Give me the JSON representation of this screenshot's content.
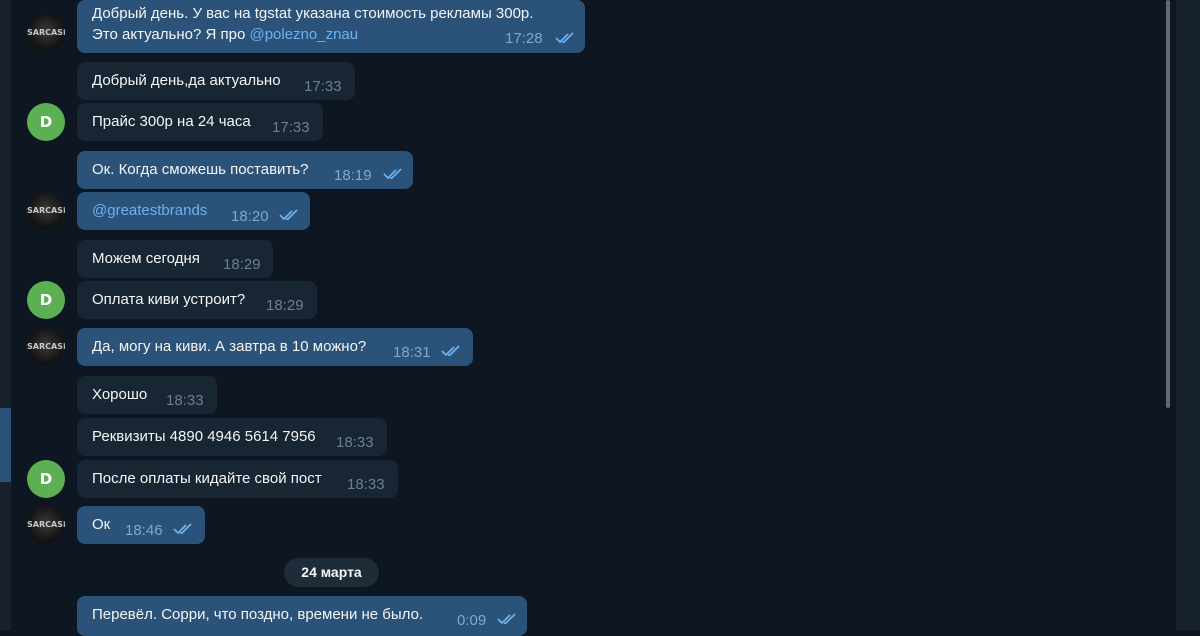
{
  "chat": {
    "messages": [
      {
        "dir": "out",
        "lines": [
          "Добрый день. У вас на tgstat указана стоимость рекламы 300р.",
          "Это актуально? Я про "
        ],
        "mention": "@polezno_znau",
        "time": "17:28",
        "read": true
      },
      {
        "dir": "in",
        "text": "Добрый день,да актуально",
        "time": "17:33"
      },
      {
        "dir": "in",
        "text": "Прайс 300р на 24 часа",
        "time": "17:33"
      },
      {
        "dir": "out",
        "text": "Ок. Когда сможешь поставить?",
        "time": "18:19",
        "read": true
      },
      {
        "dir": "out",
        "mention": "@greatestbrands",
        "time": "18:20",
        "read": true
      },
      {
        "dir": "in",
        "text": "Можем сегодня",
        "time": "18:29"
      },
      {
        "dir": "in",
        "text": "Оплата киви устроит?",
        "time": "18:29"
      },
      {
        "dir": "out",
        "text": "Да, могу на киви. А завтра в 10 можно?",
        "time": "18:31",
        "read": true
      },
      {
        "dir": "in",
        "text": "Хорошо",
        "time": "18:33"
      },
      {
        "dir": "in",
        "text": "Реквизиты 4890 4946 5614 7956",
        "time": "18:33"
      },
      {
        "dir": "in",
        "text": "После оплаты кидайте свой пост",
        "time": "18:33"
      },
      {
        "dir": "out",
        "text": "Ок",
        "time": "18:46",
        "read": true
      },
      {
        "dir": "out",
        "text": "Перевёл. Сорри, что поздно, времени не было.",
        "time": "0:09",
        "read": true
      }
    ],
    "date_separator": "24 марта",
    "avatars": {
      "self_photo_text": "SARCASM",
      "peer_letter": "D"
    }
  },
  "colors": {
    "background": "#0e1621",
    "incoming_bubble": "#182533",
    "outgoing_bubble": "#2b5278",
    "mention": "#6ab2f2",
    "peer_avatar": "#5cb053"
  },
  "icons": {
    "read_receipt": "double-check-icon"
  }
}
